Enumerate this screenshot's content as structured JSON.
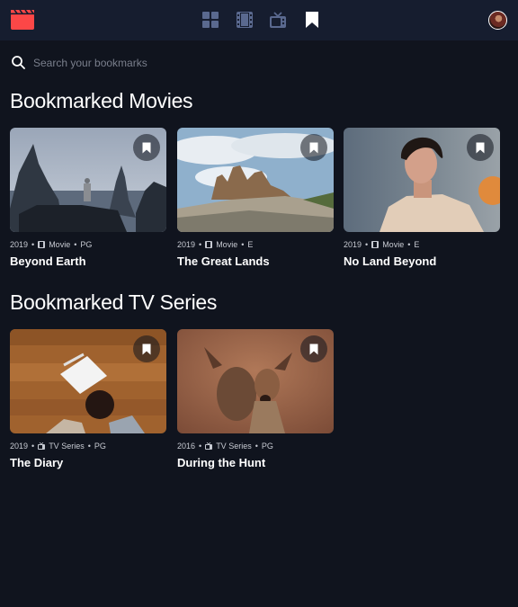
{
  "app": {
    "name": "Entertainment"
  },
  "nav": {
    "items": [
      {
        "name": "home",
        "icon": "grid-icon",
        "active": false
      },
      {
        "name": "movies",
        "icon": "film-icon",
        "active": false
      },
      {
        "name": "tv-series",
        "icon": "tv-icon",
        "active": false
      },
      {
        "name": "bookmarks",
        "icon": "bookmark-icon",
        "active": true
      }
    ]
  },
  "search": {
    "placeholder": "Search your bookmarks",
    "value": ""
  },
  "movies_section": {
    "title": "Bookmarked Movies",
    "items": [
      {
        "year": "2019",
        "category": "Movie",
        "rating": "PG",
        "title": "Beyond Earth",
        "bookmarked": true
      },
      {
        "year": "2019",
        "category": "Movie",
        "rating": "E",
        "title": "The Great Lands",
        "bookmarked": true
      },
      {
        "year": "2019",
        "category": "Movie",
        "rating": "E",
        "title": "No Land Beyond",
        "bookmarked": true
      }
    ]
  },
  "tv_section": {
    "title": "Bookmarked TV Series",
    "items": [
      {
        "year": "2019",
        "category": "TV Series",
        "rating": "PG",
        "title": "The Diary",
        "bookmarked": true
      },
      {
        "year": "2016",
        "category": "TV Series",
        "rating": "PG",
        "title": "During the Hunt",
        "bookmarked": true
      }
    ]
  },
  "colors": {
    "background": "#10141e",
    "surface": "#161d2f",
    "accent": "#fc4747",
    "nav_inactive": "#5a698f",
    "text": "#ffffff"
  },
  "dot": "•"
}
